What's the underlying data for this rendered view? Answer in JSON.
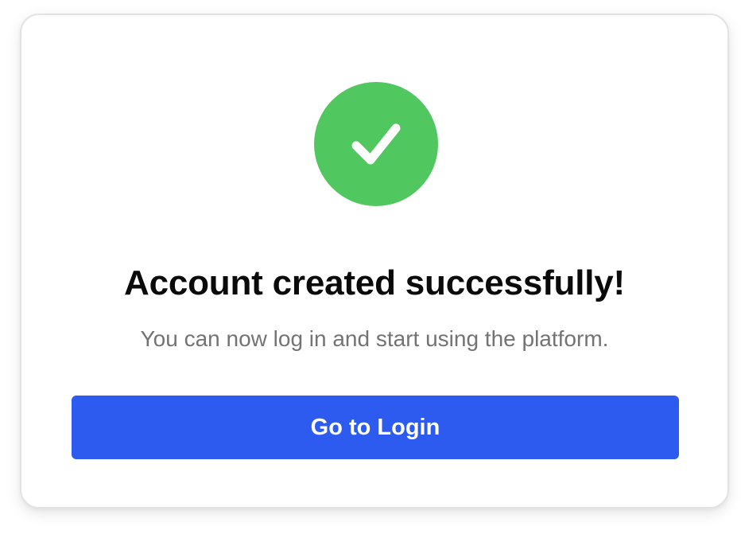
{
  "dialog": {
    "icon": "check-circle-icon",
    "title": "Account created successfully!",
    "message": "You can now log in and start using the platform.",
    "button_label": "Go to Login"
  },
  "colors": {
    "success": "#50C75F",
    "primary": "#2D5BEF",
    "title_text": "#0A0A0A",
    "message_text": "#737373"
  }
}
